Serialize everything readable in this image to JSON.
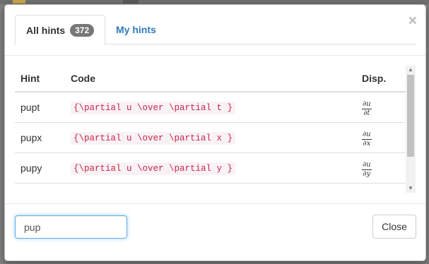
{
  "tabs": [
    {
      "label": "All hints",
      "badge": "372"
    },
    {
      "label": "My hints"
    }
  ],
  "close_glyph": "×",
  "table": {
    "headers": {
      "hint": "Hint",
      "code": "Code",
      "disp": "Disp."
    },
    "rows": [
      {
        "hint": "pupt",
        "code": "{\\partial u \\over \\partial t }",
        "disp_num": "∂u",
        "disp_den": "∂t"
      },
      {
        "hint": "pupx",
        "code": "{\\partial u \\over \\partial x }",
        "disp_num": "∂u",
        "disp_den": "∂x"
      },
      {
        "hint": "pupy",
        "code": "{\\partial u \\over \\partial y }",
        "disp_num": "∂u",
        "disp_den": "∂y"
      }
    ]
  },
  "search": {
    "value": "pup"
  },
  "footer": {
    "close_label": "Close"
  },
  "colors": {
    "link": "#337ab7",
    "code_text": "#c7254e",
    "code_bg": "#f9f2f4",
    "focus": "#66afe9",
    "badge": "#777777"
  }
}
